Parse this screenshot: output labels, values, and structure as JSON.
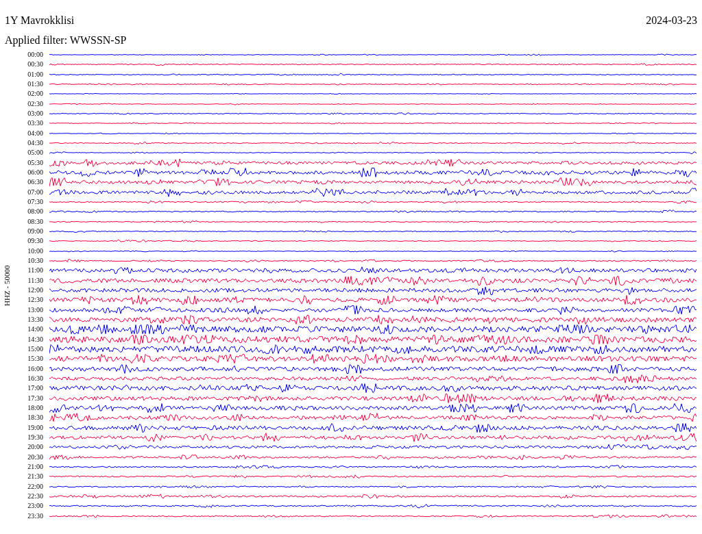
{
  "header": {
    "station": "1Y Mavrokklisi",
    "date": "2024-03-23",
    "filter": "Applied filter: WWSSN-SP"
  },
  "axis_label": "HHZ - 50000",
  "traces": [
    {
      "time": "00:00",
      "color": "#0000ff"
    },
    {
      "time": "00:30",
      "color": "#ff0040"
    },
    {
      "time": "01:00",
      "color": "#0000ff"
    },
    {
      "time": "01:30",
      "color": "#ff0040"
    },
    {
      "time": "02:00",
      "color": "#0000ff"
    },
    {
      "time": "02:30",
      "color": "#ff0040"
    },
    {
      "time": "03:00",
      "color": "#0000ff"
    },
    {
      "time": "03:30",
      "color": "#ff0040"
    },
    {
      "time": "04:00",
      "color": "#0000ff"
    },
    {
      "time": "04:30",
      "color": "#ff0040"
    },
    {
      "time": "05:00",
      "color": "#0000ff"
    },
    {
      "time": "05:30",
      "color": "#ff0040"
    },
    {
      "time": "06:00",
      "color": "#0000ff"
    },
    {
      "time": "06:30",
      "color": "#ff0040"
    },
    {
      "time": "07:00",
      "color": "#0000ff"
    },
    {
      "time": "07:30",
      "color": "#ff0040"
    },
    {
      "time": "08:00",
      "color": "#0000ff"
    },
    {
      "time": "08:30",
      "color": "#ff0040"
    },
    {
      "time": "09:00",
      "color": "#0000ff"
    },
    {
      "time": "09:30",
      "color": "#ff0040"
    },
    {
      "time": "10:00",
      "color": "#0000ff"
    },
    {
      "time": "10:30",
      "color": "#ff0040"
    },
    {
      "time": "11:00",
      "color": "#0000ff"
    },
    {
      "time": "11:30",
      "color": "#ff0040"
    },
    {
      "time": "12:00",
      "color": "#0000ff"
    },
    {
      "time": "12:30",
      "color": "#ff0040"
    },
    {
      "time": "13:00",
      "color": "#0000ff"
    },
    {
      "time": "13:30",
      "color": "#ff0040"
    },
    {
      "time": "14:00",
      "color": "#0000ff"
    },
    {
      "time": "14:30",
      "color": "#ff0040"
    },
    {
      "time": "15:00",
      "color": "#0000ff"
    },
    {
      "time": "15:30",
      "color": "#ff0040"
    },
    {
      "time": "16:00",
      "color": "#0000ff"
    },
    {
      "time": "16:30",
      "color": "#ff0040"
    },
    {
      "time": "17:00",
      "color": "#0000ff"
    },
    {
      "time": "17:30",
      "color": "#ff0040"
    },
    {
      "time": "18:00",
      "color": "#0000ff"
    },
    {
      "time": "18:30",
      "color": "#ff0040"
    },
    {
      "time": "19:00",
      "color": "#0000ff"
    },
    {
      "time": "19:30",
      "color": "#ff0040"
    },
    {
      "time": "20:00",
      "color": "#0000ff"
    },
    {
      "time": "20:30",
      "color": "#ff0040"
    },
    {
      "time": "21:00",
      "color": "#0000ff"
    },
    {
      "time": "21:30",
      "color": "#ff0040"
    },
    {
      "time": "22:00",
      "color": "#0000ff"
    },
    {
      "time": "22:30",
      "color": "#ff0040"
    },
    {
      "time": "23:00",
      "color": "#0000ff"
    },
    {
      "time": "23:30",
      "color": "#ff0040"
    }
  ]
}
